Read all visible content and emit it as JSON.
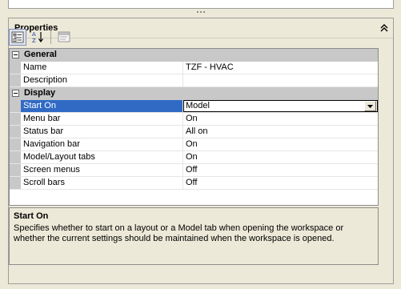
{
  "panel": {
    "title": "Properties"
  },
  "toolbar": {
    "icons": [
      "categorized-view-icon",
      "alphabetical-sort-icon",
      "property-pages-icon"
    ]
  },
  "grid": {
    "categories": [
      {
        "label": "General",
        "rows": [
          {
            "name": "Name",
            "value": "TZF - HVAC"
          },
          {
            "name": "Description",
            "value": ""
          }
        ]
      },
      {
        "label": "Display",
        "rows": [
          {
            "name": "Start On",
            "value": "Model"
          },
          {
            "name": "Menu bar",
            "value": "On"
          },
          {
            "name": "Status bar",
            "value": "All on"
          },
          {
            "name": "Navigation bar",
            "value": "On"
          },
          {
            "name": "Model/Layout tabs",
            "value": "On"
          },
          {
            "name": "Screen menus",
            "value": "Off"
          },
          {
            "name": "Scroll bars",
            "value": "Off"
          }
        ]
      }
    ]
  },
  "description": {
    "title": "Start On",
    "text": "Specifies whether to start on a layout or a Model tab when opening the workspace or whether the current settings should be maintained when the workspace is opened."
  },
  "colors": {
    "selection": "#316ac5",
    "category_bg": "#c8c8c8",
    "panel_bg": "#ece9d8"
  }
}
